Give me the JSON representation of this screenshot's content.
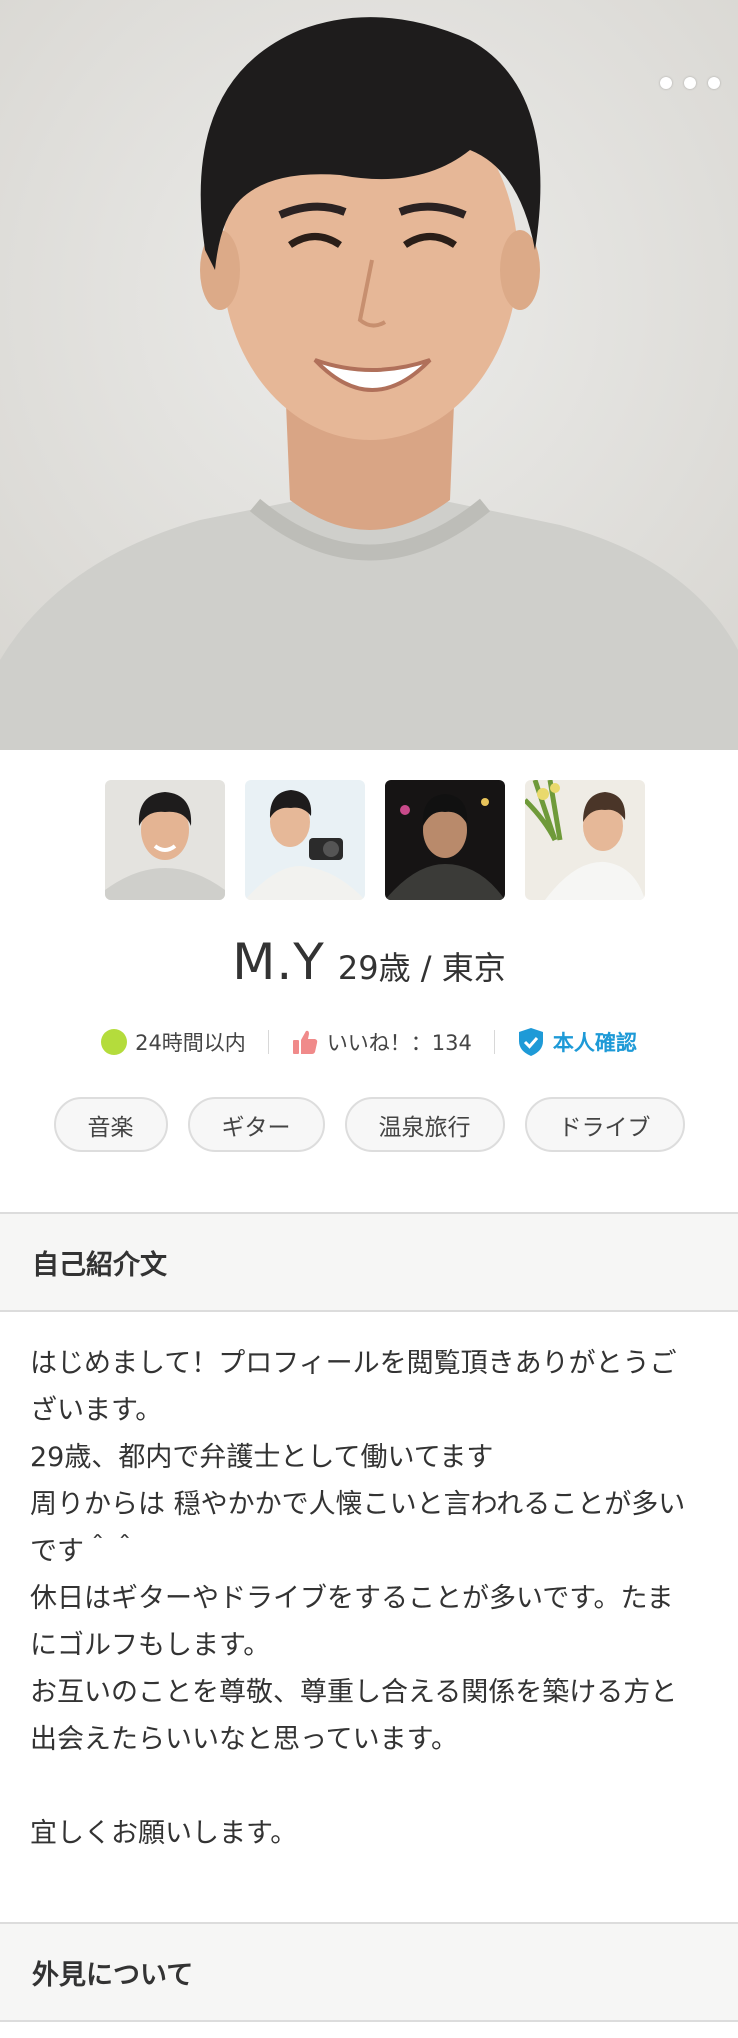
{
  "more_menu_icon": "ellipsis-horizontal-icon",
  "profile": {
    "name": "M.Y",
    "age_city": "29歳 / 東京",
    "status": [
      {
        "icon": "online-dot-icon",
        "text": "24時間以内"
      },
      {
        "icon": "thumbs-up-icon",
        "text": "いいね！：134"
      },
      {
        "icon": "shield-check-icon",
        "text": "本人確認"
      }
    ],
    "tags": [
      "音楽",
      "ギター",
      "温泉旅行",
      "ドライブ"
    ]
  },
  "sections": {
    "intro_title": "自己紹介文",
    "intro_lines": [
      "はじめまして！プロフィールを閲覧頂きありがとうご",
      "ざいます。",
      "29歳、都内で弁護士として働いてます",
      "周りからは 穏やかかで人懐こいと言われることが多い",
      "です＾＾",
      "休日はギターやドライブをすることが多いです。たま",
      "にゴルフもします。",
      "お互いのことを尊敬、尊重し合える関係を築ける方と",
      "出会えたらいいなと思っています。",
      "",
      "宜しくお願いします。"
    ],
    "appearance_title": "外見について"
  },
  "colors": {
    "online": "#b4dc3c",
    "like": "#f08a8a",
    "verified": "#1e9ad7"
  }
}
